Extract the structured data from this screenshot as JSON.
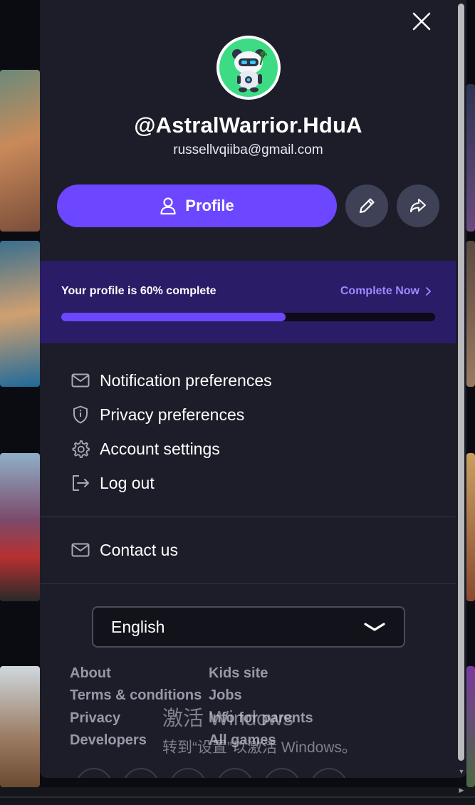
{
  "panel": {
    "username": "@AstralWarrior.HduA",
    "email": "russellvqiiba@gmail.com",
    "profile_button": "Profile",
    "progress": {
      "text": "Your profile is 60% complete",
      "action": "Complete Now",
      "percent": 60
    },
    "menu": [
      {
        "label": "Notification preferences",
        "icon": "mail-icon"
      },
      {
        "label": "Privacy preferences",
        "icon": "shield-icon"
      },
      {
        "label": "Account settings",
        "icon": "gear-icon"
      },
      {
        "label": "Log out",
        "icon": "logout-icon"
      }
    ],
    "contact": {
      "label": "Contact us",
      "icon": "mail-icon"
    },
    "language": {
      "selected": "English"
    },
    "footer_links": {
      "left": [
        "About",
        "Terms & conditions",
        "Privacy",
        "Developers"
      ],
      "right": [
        "Kids site",
        "Jobs",
        "Info for parents",
        "All games"
      ]
    }
  },
  "watermark": {
    "line1": "激活 Windows",
    "line2": "转到“设置”以激活 Windows。"
  },
  "colors": {
    "panel_bg": "#1c1d28",
    "accent": "#6c47ff",
    "progress_card_bg": "#2a1c66",
    "link_accent": "#9d8bff"
  }
}
